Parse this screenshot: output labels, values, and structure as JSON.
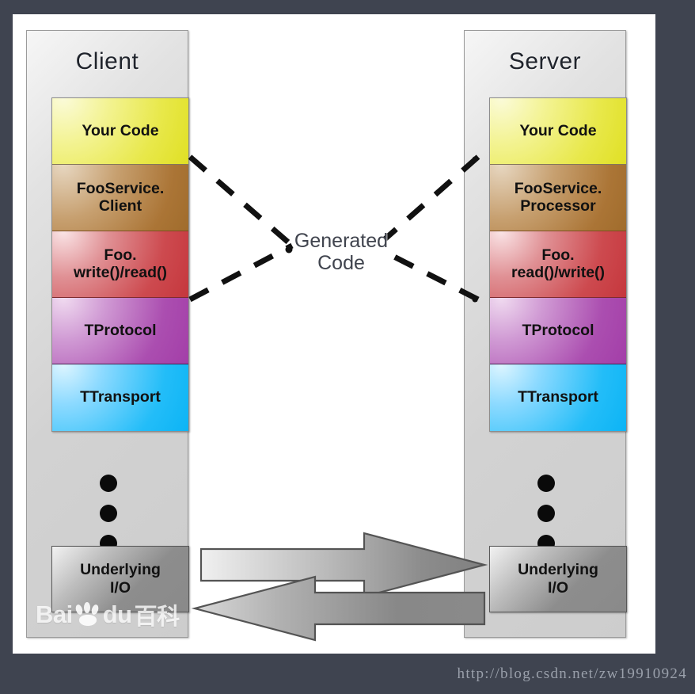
{
  "background_color": "#3f4450",
  "canvas_color": "#ffffff",
  "columns": [
    {
      "id": "client",
      "title": "Client",
      "layers": [
        {
          "name": "your-code",
          "label": "Your Code",
          "color": "#e8e84a"
        },
        {
          "name": "foo-service",
          "label": "FooService.\nClient",
          "color": "#ab7536"
        },
        {
          "name": "foo-rw",
          "label": "Foo.\nwrite()/read()",
          "color": "#cd4a4f"
        },
        {
          "name": "tprotocol",
          "label": "TProtocol",
          "color": "#ab4eb0"
        },
        {
          "name": "ttransport",
          "label": "TTransport",
          "color": "#23bdf8"
        }
      ],
      "ellipsis_dots": 3,
      "io_box_label": "Underlying\nI/O"
    },
    {
      "id": "server",
      "title": "Server",
      "layers": [
        {
          "name": "your-code",
          "label": "Your Code",
          "color": "#e8e84a"
        },
        {
          "name": "foo-service",
          "label": "FooService.\nProcessor",
          "color": "#ab7536"
        },
        {
          "name": "foo-rw",
          "label": "Foo.\nread()/write()",
          "color": "#cd4a4f"
        },
        {
          "name": "tprotocol",
          "label": "TProtocol",
          "color": "#ab4eb0"
        },
        {
          "name": "ttransport",
          "label": "TTransport",
          "color": "#23bdf8"
        }
      ],
      "ellipsis_dots": 3,
      "io_box_label": "Underlying\nI/O"
    }
  ],
  "center_label": {
    "line1": "Generated",
    "line2": "Code"
  },
  "arrows": [
    {
      "name": "client-to-server-arrow",
      "direction": "right"
    },
    {
      "name": "server-to-client-arrow",
      "direction": "left"
    }
  ],
  "watermark": {
    "text_left": "Bai",
    "text_right": "du",
    "text_cn": "百科"
  },
  "caption": {
    "url": "http://blog.csdn.net/zw19910924"
  }
}
